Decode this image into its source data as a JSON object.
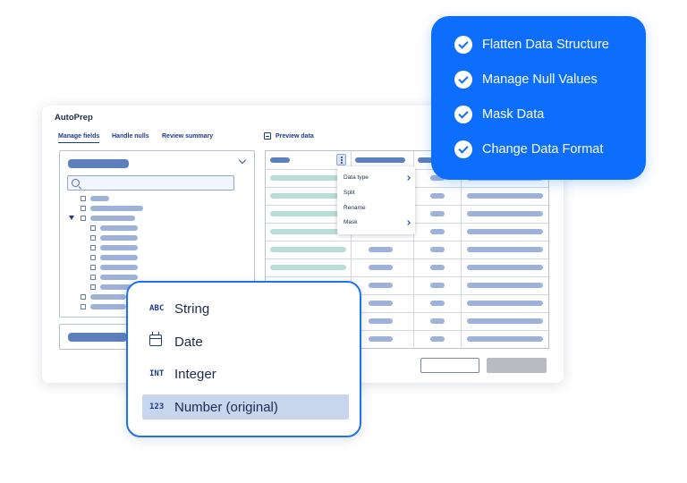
{
  "app": {
    "title": "AutoPrep",
    "tabs": [
      {
        "label": "Manage fields",
        "active": true
      },
      {
        "label": "Handle nulls",
        "active": false
      },
      {
        "label": "Review summary",
        "active": false
      }
    ],
    "preview_label": "Preview data",
    "field_search": {
      "placeholder": ""
    }
  },
  "context_menu": {
    "items": [
      {
        "label": "Data type",
        "has_submenu": true
      },
      {
        "label": "Split",
        "has_submenu": false
      },
      {
        "label": "Rename",
        "has_submenu": false
      },
      {
        "label": "Mask",
        "has_submenu": true
      }
    ]
  },
  "features": [
    {
      "label": "Flatten Data Structure",
      "icon": "check-circle-icon"
    },
    {
      "label": "Manage Null Values",
      "icon": "check-circle-icon"
    },
    {
      "label": "Mask Data",
      "icon": "check-circle-icon"
    },
    {
      "label": "Change Data Format",
      "icon": "check-circle-icon"
    }
  ],
  "data_types": [
    {
      "icon_text": "ABC",
      "label": "String",
      "selected": false
    },
    {
      "icon_text": "",
      "icon": "calendar-icon",
      "label": "Date",
      "selected": false
    },
    {
      "icon_text": "INT",
      "label": "Integer",
      "selected": false
    },
    {
      "icon_text": "123",
      "label": "Number (original)",
      "selected": true
    }
  ],
  "colors": {
    "accent": "#0d6efd",
    "navy": "#1d3a8a",
    "selected_row": "#c8d6ed",
    "placeholder_dark": "#5e7fbd",
    "placeholder_light": "#9eb1d8",
    "placeholder_green": "#b8ddd7"
  }
}
